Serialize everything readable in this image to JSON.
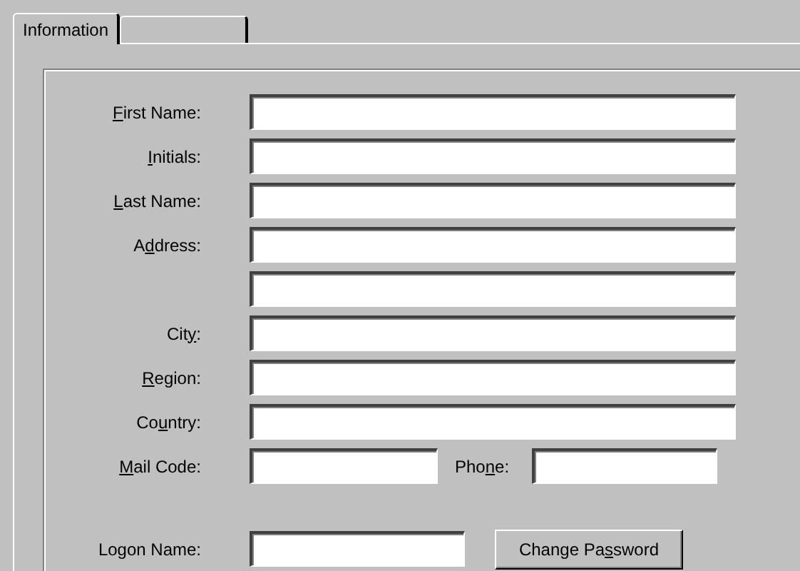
{
  "tabs": [
    {
      "label": "Information",
      "selected": true
    },
    {
      "selected": false
    }
  ],
  "fields": [
    {
      "label": {
        "key": "F",
        "after": "irst Name:"
      },
      "kind": "wide"
    },
    {
      "label": {
        "key": "I",
        "after": "nitials:"
      },
      "kind": "wide"
    },
    {
      "label": {
        "key": "L",
        "after": "ast Name:"
      },
      "kind": "wide"
    },
    {
      "label": {
        "before": "A",
        "key": "d",
        "after": "dress:"
      },
      "kind": "wide"
    },
    {
      "kind": "wide"
    },
    {
      "label": {
        "before": "Cit",
        "key": "y",
        "after": ":"
      },
      "kind": "wide"
    },
    {
      "label": {
        "key": "R",
        "after": "egion:"
      },
      "kind": "wide"
    },
    {
      "label": {
        "before": "Co",
        "key": "u",
        "after": "ntry:"
      },
      "kind": "wide"
    },
    {
      "label": {
        "key": "M",
        "after": "ail Code:"
      },
      "kind": "split",
      "second_label": {
        "before": "Pho",
        "key": "n",
        "after": "e:"
      }
    }
  ],
  "logon": {
    "label": {
      "before": "Logon Name:"
    },
    "button": {
      "before": "Change Pa",
      "key": "s",
      "after": "sword"
    }
  }
}
